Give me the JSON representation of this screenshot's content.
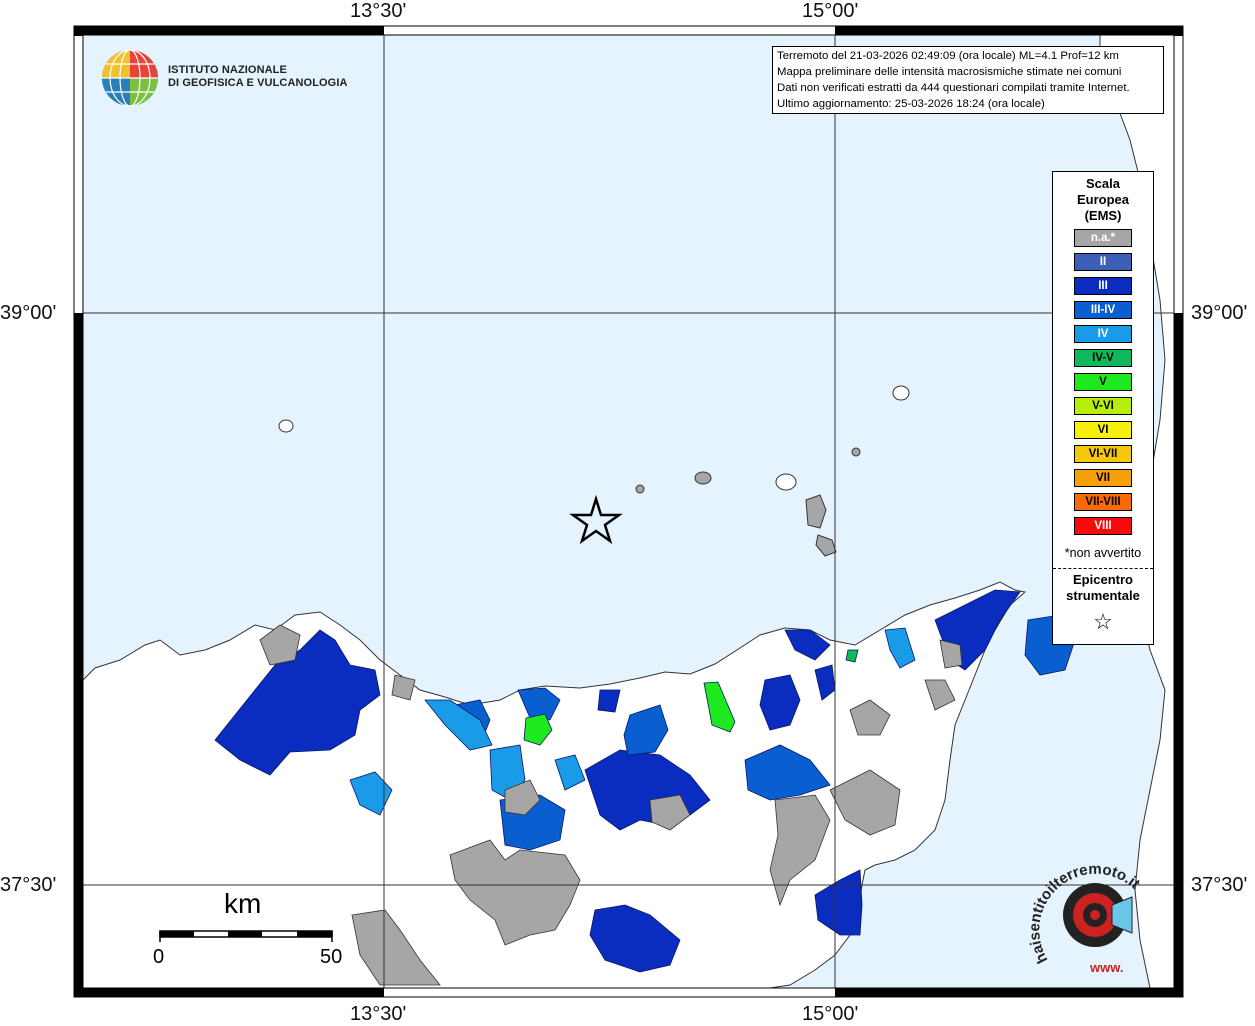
{
  "axes": {
    "top_labels": [
      "13°30'",
      "15°00'"
    ],
    "bottom_labels": [
      "13°30'",
      "15°00'"
    ],
    "left_labels": [
      "39°00'",
      "37°30'"
    ],
    "right_labels": [
      "39°00'",
      "37°30'"
    ]
  },
  "info": {
    "lines": [
      "Terremoto del 21-03-2026 02:49:09 (ora locale) ML=4.1 Prof=12 km",
      "Mappa preliminare delle intensità macrosismiche stimate nei comuni",
      "Dati non verificati estratti da 444 questionari compilati tramite Internet.",
      "Ultimo aggiornamento: 25-03-2026 18:24 (ora locale)"
    ]
  },
  "logo": {
    "line1": "ISTITUTO NAZIONALE",
    "line2": "DI GEOFISICA E VULCANOLOGIA"
  },
  "legend": {
    "title_lines": [
      "Scala",
      "Europea",
      "(EMS)"
    ],
    "items": [
      {
        "label": "n.a.*",
        "color": "#a6a6a6",
        "text_color": "#ffffff"
      },
      {
        "label": "II",
        "color": "#3d5fb5",
        "text_color": "#ffffff"
      },
      {
        "label": "III",
        "color": "#0a2dbf",
        "text_color": "#ffffff"
      },
      {
        "label": "III-IV",
        "color": "#0a5fd0",
        "text_color": "#ffffff"
      },
      {
        "label": "IV",
        "color": "#1a9be8",
        "text_color": "#ffffff"
      },
      {
        "label": "IV-V",
        "color": "#0fb85a",
        "text_color": "#000000"
      },
      {
        "label": "V",
        "color": "#1ee81e",
        "text_color": "#000000"
      },
      {
        "label": "V-VI",
        "color": "#b6f00a",
        "text_color": "#000000"
      },
      {
        "label": "VI",
        "color": "#f6f00a",
        "text_color": "#000000"
      },
      {
        "label": "VI-VII",
        "color": "#f6c80a",
        "text_color": "#000000"
      },
      {
        "label": "VII",
        "color": "#f6a00a",
        "text_color": "#000000"
      },
      {
        "label": "VII-VIII",
        "color": "#f66a0a",
        "text_color": "#000000"
      },
      {
        "label": "VIII",
        "color": "#f60a0a",
        "text_color": "#ffffff"
      }
    ],
    "note": "*non avvertito",
    "epicenter_lines": [
      "Epicentro",
      "strumentale"
    ]
  },
  "scale_bar": {
    "unit": "km",
    "start": "0",
    "end": "50"
  },
  "watermark": {
    "text": "haisentitoilterremoto.it",
    "url_text": "www."
  },
  "colors": {
    "sea": "#e4f3fd",
    "land": "#ffffff"
  }
}
